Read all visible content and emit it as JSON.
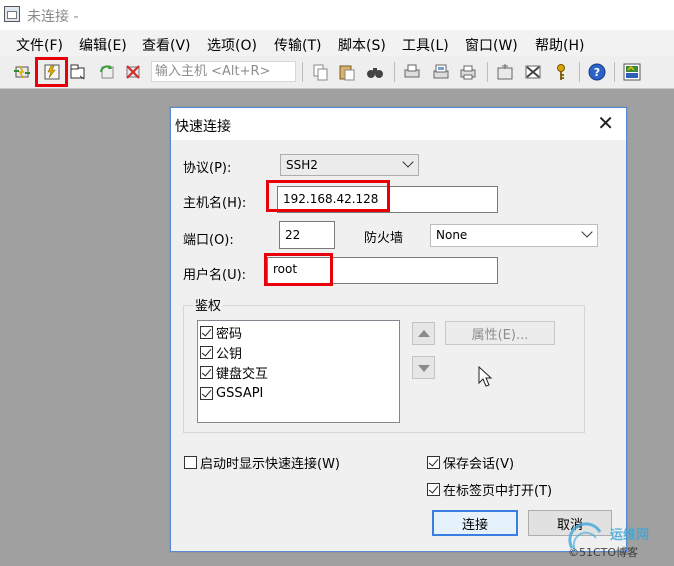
{
  "window": {
    "title": "未连接 -"
  },
  "menu": [
    "文件(F)",
    "编辑(E)",
    "查看(V)",
    "选项(O)",
    "传输(T)",
    "脚本(S)",
    "工具(L)",
    "窗口(W)",
    "帮助(H)"
  ],
  "toolbar": {
    "host_placeholder": "输入主机 <Alt+R>",
    "icons": [
      "connect-icon",
      "quick-connect-icon",
      "connect-in-tab-icon",
      "reconnect-icon",
      "disconnect-icon",
      "copy-icon",
      "paste-icon",
      "find-icon",
      "print-setup-icon",
      "print-screen-icon",
      "print-icon",
      "session-options-icon",
      "global-options-icon",
      "key-icon",
      "help-icon",
      "sftp-icon"
    ]
  },
  "dialog": {
    "title": "快速连接",
    "protocol_label": "协议(P):",
    "protocol_value": "SSH2",
    "hostname_label": "主机名(H):",
    "hostname_value": "192.168.42.128",
    "port_label": "端口(O):",
    "port_value": "22",
    "firewall_label": "防火墙",
    "firewall_value": "None",
    "username_label": "用户名(U):",
    "username_value": "root",
    "auth_label": "鉴权",
    "auth_methods": [
      {
        "label": "密码",
        "checked": true
      },
      {
        "label": "公钥",
        "checked": true
      },
      {
        "label": "键盘交互",
        "checked": true
      },
      {
        "label": "GSSAPI",
        "checked": true
      }
    ],
    "properties_button": "属性(E)...",
    "show_on_startup_label": "启动时显示快速连接(W)",
    "save_session_label": "保存会话(V)",
    "open_in_tab_label": "在标签页中打开(T)",
    "connect_button": "连接",
    "cancel_button": "取消"
  },
  "watermark": {
    "line1": "运维网",
    "line2": "©51CTO博客"
  },
  "colors": {
    "highlight": "#e8000b",
    "dialog_border": "#5a8ad6",
    "default_button": "#3a7ee4"
  }
}
